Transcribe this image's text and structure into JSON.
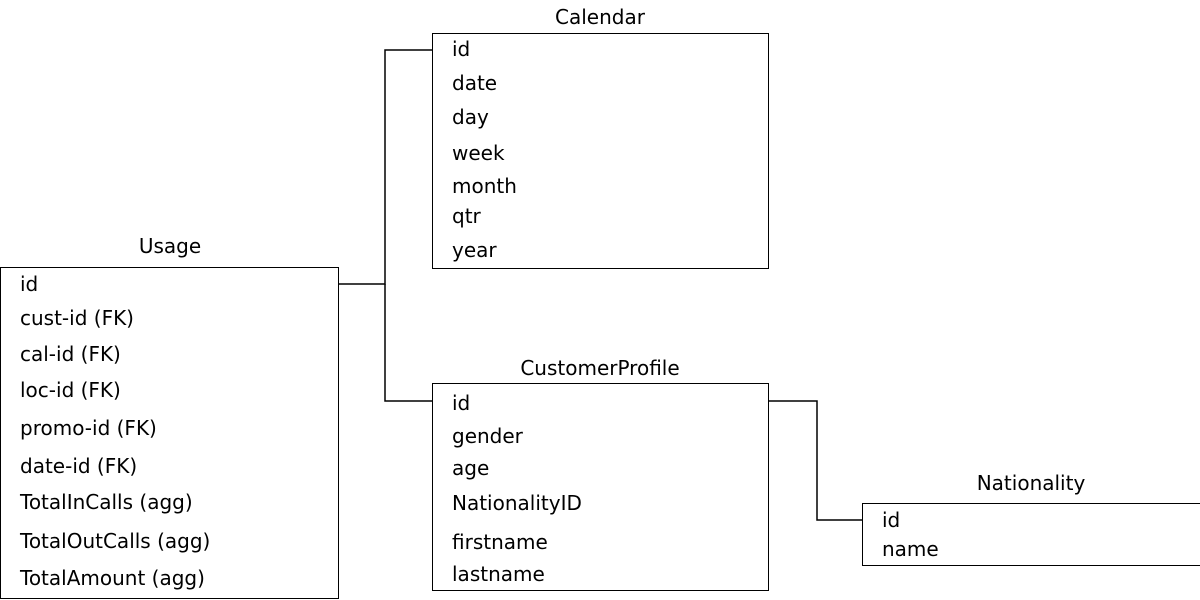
{
  "tables": [
    {
      "name": "Usage",
      "fields": [
        "id",
        "cust-id (FK)",
        "cal-id (FK)",
        "loc-id (FK)",
        "promo-id (FK)",
        "date-id (FK)",
        "TotalInCalls (agg)",
        "TotalOutCalls (agg)",
        "TotalAmount (agg)"
      ]
    },
    {
      "name": "Calendar",
      "fields": [
        "id",
        "date",
        "day",
        "week",
        "month",
        "qtr",
        "year"
      ]
    },
    {
      "name": "CustomerProfile",
      "fields": [
        "id",
        "gender",
        "age",
        "NationalityID",
        "firstname",
        "lastname"
      ]
    },
    {
      "name": "Nationality",
      "fields": [
        "id",
        "name"
      ]
    }
  ],
  "relationships": [
    {
      "from": "Usage",
      "to": "Calendar"
    },
    {
      "from": "Usage",
      "to": "CustomerProfile"
    },
    {
      "from": "CustomerProfile",
      "to": "Nationality"
    }
  ]
}
